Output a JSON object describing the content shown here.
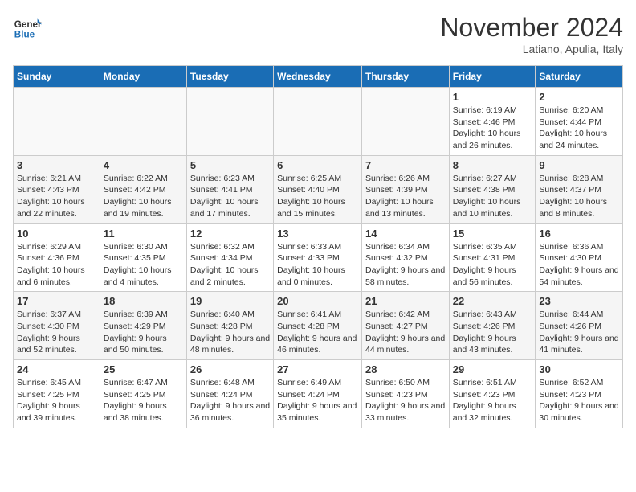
{
  "header": {
    "logo_line1": "General",
    "logo_line2": "Blue",
    "month_title": "November 2024",
    "location": "Latiano, Apulia, Italy"
  },
  "weekdays": [
    "Sunday",
    "Monday",
    "Tuesday",
    "Wednesday",
    "Thursday",
    "Friday",
    "Saturday"
  ],
  "weeks": [
    [
      {
        "day": "",
        "info": ""
      },
      {
        "day": "",
        "info": ""
      },
      {
        "day": "",
        "info": ""
      },
      {
        "day": "",
        "info": ""
      },
      {
        "day": "",
        "info": ""
      },
      {
        "day": "1",
        "info": "Sunrise: 6:19 AM\nSunset: 4:46 PM\nDaylight: 10 hours and 26 minutes."
      },
      {
        "day": "2",
        "info": "Sunrise: 6:20 AM\nSunset: 4:44 PM\nDaylight: 10 hours and 24 minutes."
      }
    ],
    [
      {
        "day": "3",
        "info": "Sunrise: 6:21 AM\nSunset: 4:43 PM\nDaylight: 10 hours and 22 minutes."
      },
      {
        "day": "4",
        "info": "Sunrise: 6:22 AM\nSunset: 4:42 PM\nDaylight: 10 hours and 19 minutes."
      },
      {
        "day": "5",
        "info": "Sunrise: 6:23 AM\nSunset: 4:41 PM\nDaylight: 10 hours and 17 minutes."
      },
      {
        "day": "6",
        "info": "Sunrise: 6:25 AM\nSunset: 4:40 PM\nDaylight: 10 hours and 15 minutes."
      },
      {
        "day": "7",
        "info": "Sunrise: 6:26 AM\nSunset: 4:39 PM\nDaylight: 10 hours and 13 minutes."
      },
      {
        "day": "8",
        "info": "Sunrise: 6:27 AM\nSunset: 4:38 PM\nDaylight: 10 hours and 10 minutes."
      },
      {
        "day": "9",
        "info": "Sunrise: 6:28 AM\nSunset: 4:37 PM\nDaylight: 10 hours and 8 minutes."
      }
    ],
    [
      {
        "day": "10",
        "info": "Sunrise: 6:29 AM\nSunset: 4:36 PM\nDaylight: 10 hours and 6 minutes."
      },
      {
        "day": "11",
        "info": "Sunrise: 6:30 AM\nSunset: 4:35 PM\nDaylight: 10 hours and 4 minutes."
      },
      {
        "day": "12",
        "info": "Sunrise: 6:32 AM\nSunset: 4:34 PM\nDaylight: 10 hours and 2 minutes."
      },
      {
        "day": "13",
        "info": "Sunrise: 6:33 AM\nSunset: 4:33 PM\nDaylight: 10 hours and 0 minutes."
      },
      {
        "day": "14",
        "info": "Sunrise: 6:34 AM\nSunset: 4:32 PM\nDaylight: 9 hours and 58 minutes."
      },
      {
        "day": "15",
        "info": "Sunrise: 6:35 AM\nSunset: 4:31 PM\nDaylight: 9 hours and 56 minutes."
      },
      {
        "day": "16",
        "info": "Sunrise: 6:36 AM\nSunset: 4:30 PM\nDaylight: 9 hours and 54 minutes."
      }
    ],
    [
      {
        "day": "17",
        "info": "Sunrise: 6:37 AM\nSunset: 4:30 PM\nDaylight: 9 hours and 52 minutes."
      },
      {
        "day": "18",
        "info": "Sunrise: 6:39 AM\nSunset: 4:29 PM\nDaylight: 9 hours and 50 minutes."
      },
      {
        "day": "19",
        "info": "Sunrise: 6:40 AM\nSunset: 4:28 PM\nDaylight: 9 hours and 48 minutes."
      },
      {
        "day": "20",
        "info": "Sunrise: 6:41 AM\nSunset: 4:28 PM\nDaylight: 9 hours and 46 minutes."
      },
      {
        "day": "21",
        "info": "Sunrise: 6:42 AM\nSunset: 4:27 PM\nDaylight: 9 hours and 44 minutes."
      },
      {
        "day": "22",
        "info": "Sunrise: 6:43 AM\nSunset: 4:26 PM\nDaylight: 9 hours and 43 minutes."
      },
      {
        "day": "23",
        "info": "Sunrise: 6:44 AM\nSunset: 4:26 PM\nDaylight: 9 hours and 41 minutes."
      }
    ],
    [
      {
        "day": "24",
        "info": "Sunrise: 6:45 AM\nSunset: 4:25 PM\nDaylight: 9 hours and 39 minutes."
      },
      {
        "day": "25",
        "info": "Sunrise: 6:47 AM\nSunset: 4:25 PM\nDaylight: 9 hours and 38 minutes."
      },
      {
        "day": "26",
        "info": "Sunrise: 6:48 AM\nSunset: 4:24 PM\nDaylight: 9 hours and 36 minutes."
      },
      {
        "day": "27",
        "info": "Sunrise: 6:49 AM\nSunset: 4:24 PM\nDaylight: 9 hours and 35 minutes."
      },
      {
        "day": "28",
        "info": "Sunrise: 6:50 AM\nSunset: 4:23 PM\nDaylight: 9 hours and 33 minutes."
      },
      {
        "day": "29",
        "info": "Sunrise: 6:51 AM\nSunset: 4:23 PM\nDaylight: 9 hours and 32 minutes."
      },
      {
        "day": "30",
        "info": "Sunrise: 6:52 AM\nSunset: 4:23 PM\nDaylight: 9 hours and 30 minutes."
      }
    ]
  ]
}
